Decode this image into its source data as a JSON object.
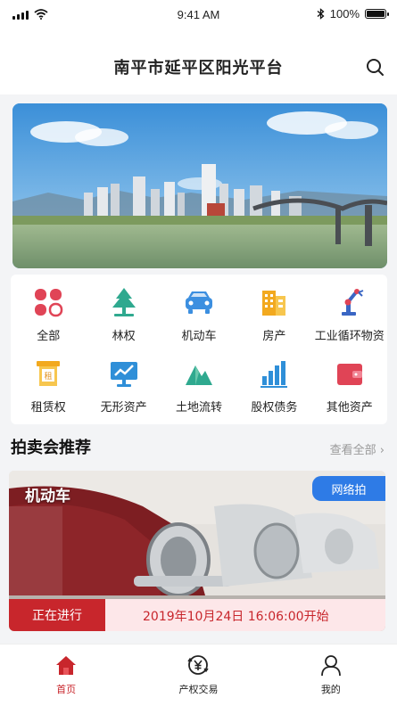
{
  "status_bar": {
    "time": "9:41 AM",
    "battery": "100%"
  },
  "header": {
    "title": "南平市延平区阳光平台"
  },
  "categories": [
    {
      "label": "全部",
      "icon": "grid-icon"
    },
    {
      "label": "林权",
      "icon": "tree-icon"
    },
    {
      "label": "机动车",
      "icon": "car-icon"
    },
    {
      "label": "房产",
      "icon": "building-icon"
    },
    {
      "label": "工业循环物资",
      "icon": "robot-arm-icon"
    },
    {
      "label": "租赁权",
      "icon": "lease-icon"
    },
    {
      "label": "无形资产",
      "icon": "chart-monitor-icon"
    },
    {
      "label": "土地流转",
      "icon": "mountain-icon"
    },
    {
      "label": "股权债务",
      "icon": "bar-chart-icon"
    },
    {
      "label": "其他资产",
      "icon": "wallet-icon"
    }
  ],
  "section": {
    "title": "拍卖会推荐",
    "view_all": "查看全部 ›"
  },
  "auction": {
    "category": "机动车",
    "badge": "网络拍",
    "status": "正在进行",
    "start_time": "2019年10月24日  16:06:00开始"
  },
  "tabs": [
    {
      "label": "首页",
      "icon": "home-icon",
      "active": true
    },
    {
      "label": "产权交易",
      "icon": "yuan-exchange-icon",
      "active": false
    },
    {
      "label": "我的",
      "icon": "user-icon",
      "active": false
    }
  ],
  "colors": {
    "accent": "#c8262c",
    "badge_blue": "#2e7be6"
  }
}
